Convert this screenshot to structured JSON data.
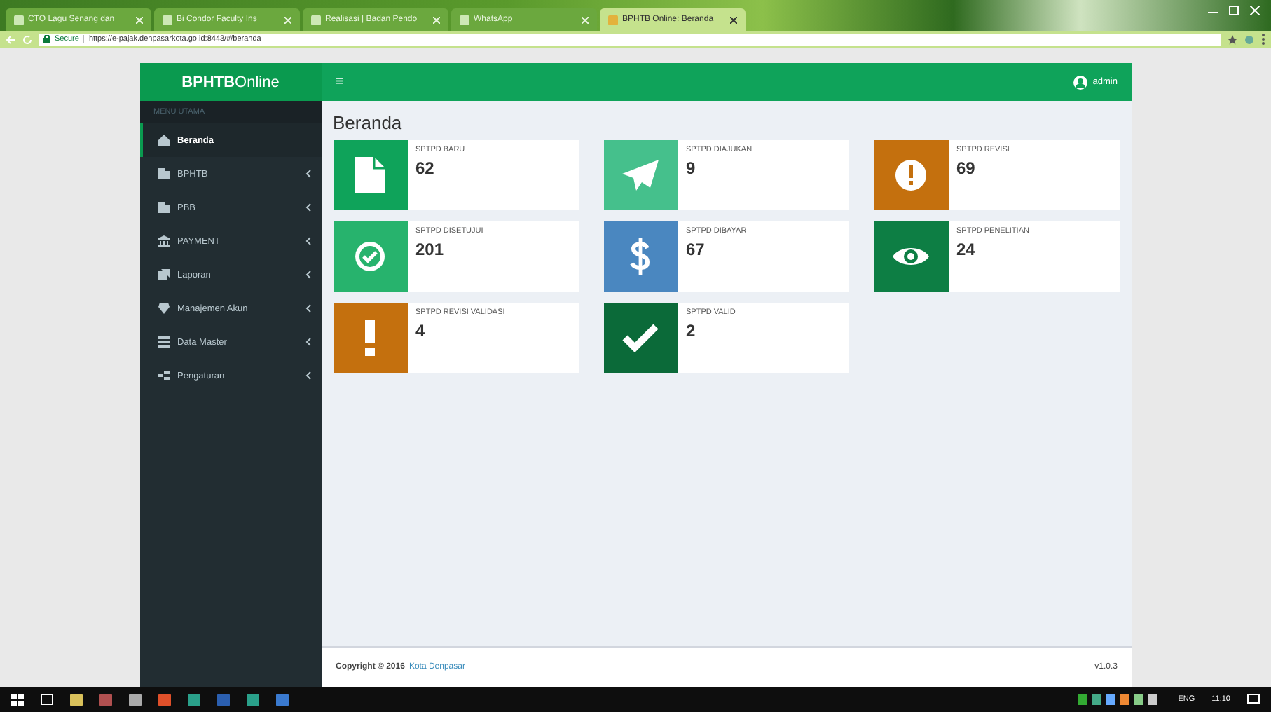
{
  "browser": {
    "tabs": [
      {
        "title": "CTO Lagu Senang dan",
        "selected": false
      },
      {
        "title": "Bi Condor Faculty Ins",
        "selected": false
      },
      {
        "title": "Realisasi | Badan Pendo",
        "selected": false
      },
      {
        "title": "WhatsApp",
        "selected": false
      },
      {
        "title": "BPHTB Online: Beranda",
        "selected": true
      }
    ],
    "security": "Secure",
    "url": "https://e-pajak.denpasarkota.go.id:8443/#/beranda"
  },
  "app": {
    "brand_bold": "BPHTB",
    "brand_light": "Online",
    "menu_toggle": "≡",
    "user": "admin",
    "sidebar": {
      "header": "MENU UTAMA",
      "items": [
        {
          "label": "Beranda",
          "selected": true,
          "has_children": false
        },
        {
          "label": "BPHTB",
          "selected": false,
          "has_children": true
        },
        {
          "label": "PBB",
          "selected": false,
          "has_children": true
        },
        {
          "label": "PAYMENT",
          "selected": false,
          "has_children": true
        },
        {
          "label": "Laporan",
          "selected": false,
          "has_children": true
        },
        {
          "label": "Manajemen Akun",
          "selected": false,
          "has_children": true
        },
        {
          "label": "Data Master",
          "selected": false,
          "has_children": true
        },
        {
          "label": "Pengaturan",
          "selected": false,
          "has_children": true
        }
      ]
    },
    "page_title": "Beranda",
    "cards": [
      {
        "label": "SPTPD BARU",
        "value": "62",
        "color": "#0fa35a"
      },
      {
        "label": "SPTPD DIAJUKAN",
        "value": "9",
        "color": "#45c08c"
      },
      {
        "label": "SPTPD REVISI",
        "value": "69",
        "color": "#c4700e"
      },
      {
        "label": "SPTPD DISETUJUI",
        "value": "201",
        "color": "#27b36d"
      },
      {
        "label": "SPTPD DIBAYAR",
        "value": "67",
        "color": "#4a87c0"
      },
      {
        "label": "SPTPD PENELITIAN",
        "value": "24",
        "color": "#0d7e44"
      },
      {
        "label": "SPTPD REVISI VALIDASI",
        "value": "4",
        "color": "#c4700e"
      },
      {
        "label": "SPTPD VALID",
        "value": "2",
        "color": "#0b6a39"
      }
    ],
    "footer": {
      "copyright": "Copyright © 2016",
      "link": "Kota Denpasar",
      "version": "v1.0.3"
    }
  },
  "taskbar": {
    "language": "ENG",
    "time": "11:10"
  }
}
